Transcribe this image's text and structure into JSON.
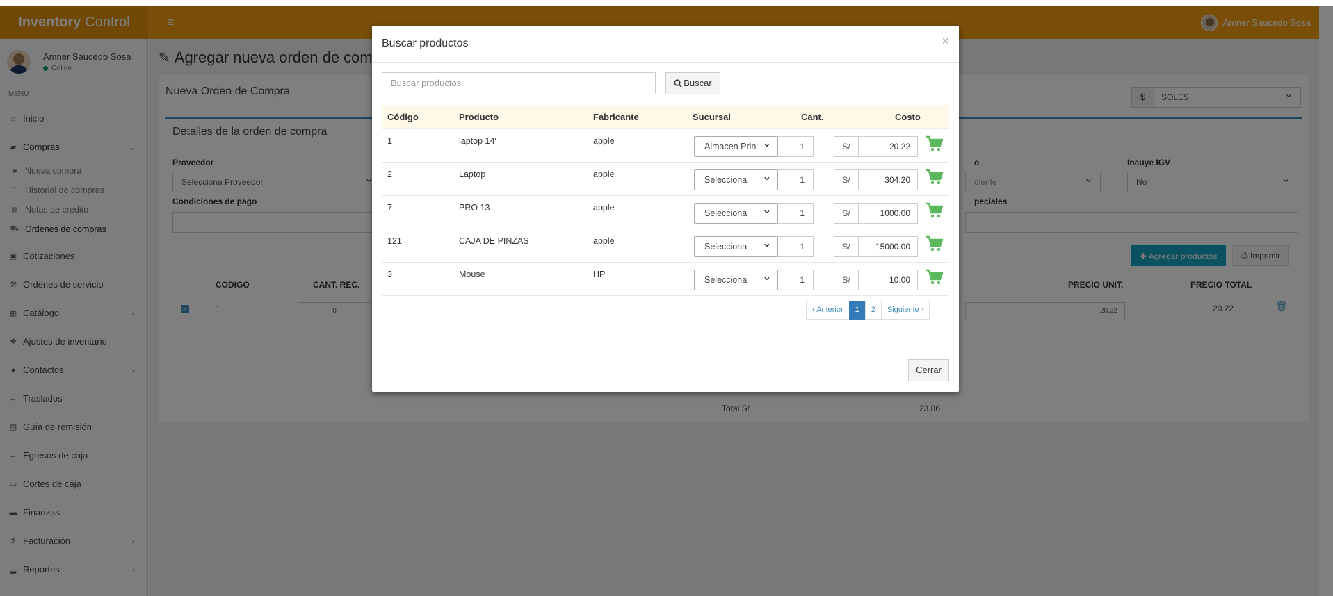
{
  "header": {
    "brand_bold": "Inventory",
    "brand_light": "Control",
    "user_name": "Amner Saucedo Sosa"
  },
  "sidebar": {
    "user_name": "Amner Saucedo Sosa",
    "status": "Online",
    "menu_header": "MENÚ",
    "items": [
      {
        "label": "Inicio",
        "icon": "home-icon"
      },
      {
        "label": "Compras",
        "icon": "truck-icon"
      },
      {
        "label": "Cotizaciones",
        "icon": "briefcase-icon"
      },
      {
        "label": "Ordenes de servicio",
        "icon": "wrench-icon"
      },
      {
        "label": "Catálogo",
        "icon": "grid-icon"
      },
      {
        "label": "Ajustes de inventario",
        "icon": "cubes-icon"
      },
      {
        "label": "Contactos",
        "icon": "user-icon"
      },
      {
        "label": "Traslados",
        "icon": "arrows-h-icon"
      },
      {
        "label": "Guía de remisión",
        "icon": "file-icon"
      },
      {
        "label": "Egresos de caja",
        "icon": "arrow-left-icon"
      },
      {
        "label": "Cortes de caja",
        "icon": "money-icon"
      },
      {
        "label": "Finanzas",
        "icon": "credit-card-icon"
      },
      {
        "label": "Facturación",
        "icon": "dollar-icon"
      },
      {
        "label": "Reportes",
        "icon": "bar-chart-icon"
      }
    ],
    "compras_sub": [
      {
        "label": "Nueva compra",
        "icon": "truck-icon"
      },
      {
        "label": "Historial de compras",
        "icon": "list-icon"
      },
      {
        "label": "Notas de crédito",
        "icon": "file-icon"
      },
      {
        "label": "Ordenes de compras",
        "icon": "cart-icon"
      }
    ]
  },
  "page": {
    "title": "Agregar nueva orden de comp",
    "box_title": "Nueva Orden de Compra",
    "currency_addon": "$",
    "currency_value": "SOLES",
    "details_title": "Detalles de la orden de compra",
    "proveedor_label": "Proveedor",
    "proveedor_value": "Selecciona Proveedor",
    "condiciones_label": "Condiciones de pago",
    "estado_label_partial": "o",
    "estado_value_partial": "diente",
    "igv_label": "Incuye IGV",
    "igv_value": "No",
    "especiales_partial": "peciales",
    "add_products_button": "Agregar productos",
    "print_button": "Imprimir",
    "columns": {
      "codigo": "CODIGO",
      "cant_rec": "CANT. REC.",
      "precio_unit": "PRECIO UNIT.",
      "precio_total": "PRECIO TOTAL"
    },
    "line": {
      "codigo": "1",
      "cant_rec": "0",
      "precio_unit": "20.22",
      "precio_total": "20.22"
    },
    "total_label": "Total S/",
    "total_value": "23.86"
  },
  "modal": {
    "title": "Buscar productos",
    "close_symbol": "×",
    "search_placeholder": "Buscar productos",
    "search_button": "Buscar",
    "columns": [
      "Código",
      "Producto",
      "Fabricante",
      "Sucursal",
      "Cant.",
      "Costo"
    ],
    "currency_prefix": "S/",
    "rows": [
      {
        "codigo": "1",
        "producto": "laptop 14'",
        "fabricante": "apple",
        "sucursal": "Almacen Prin",
        "cant": "1",
        "costo": "20.22"
      },
      {
        "codigo": "2",
        "producto": "Laptop",
        "fabricante": "apple",
        "sucursal": "Selecciona",
        "cant": "1",
        "costo": "304.20"
      },
      {
        "codigo": "7",
        "producto": "PRO 13",
        "fabricante": "apple",
        "sucursal": "Selecciona",
        "cant": "1",
        "costo": "1000.00"
      },
      {
        "codigo": "121",
        "producto": "CAJA DE PINZAS",
        "fabricante": "apple",
        "sucursal": "Selecciona",
        "cant": "1",
        "costo": "15000.00"
      },
      {
        "codigo": "3",
        "producto": "Mouse",
        "fabricante": "HP",
        "sucursal": "Selecciona",
        "cant": "1",
        "costo": "10.00"
      }
    ],
    "pagination": {
      "prev": "‹ Anterior",
      "pages": [
        "1",
        "2"
      ],
      "next": "Siguiente ›",
      "active": "1"
    },
    "close_button": "Cerrar"
  },
  "colors": {
    "header": "#f39c12",
    "brand_bg": "#e08e0b",
    "accent_blue": "#3c8dbc",
    "cart_green": "#5cb85c",
    "table_head_bg": "#fdf8e7"
  }
}
